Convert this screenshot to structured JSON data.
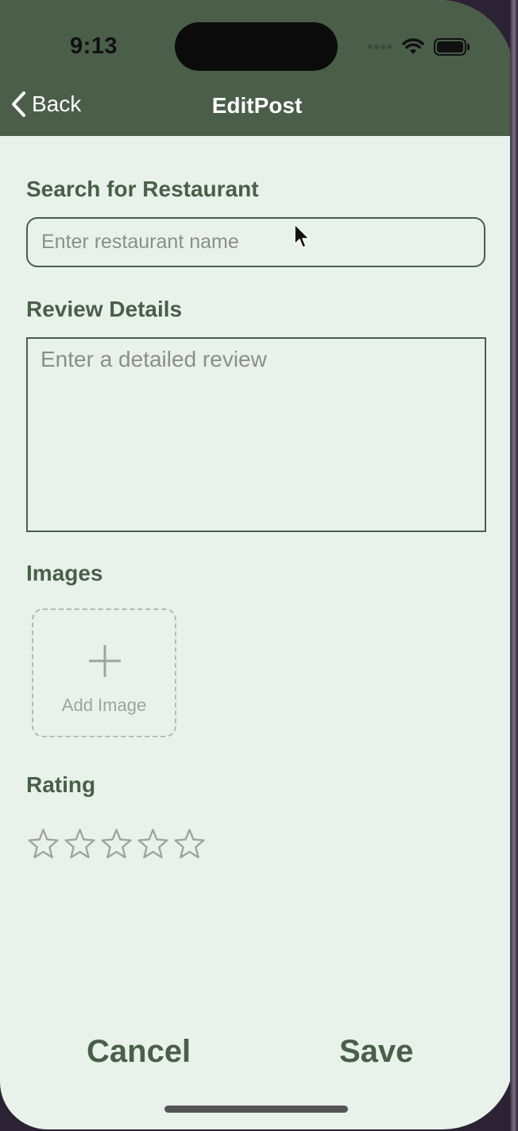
{
  "status_bar": {
    "time": "9:13"
  },
  "nav": {
    "back_label": "Back",
    "title": "EditPost"
  },
  "search": {
    "label": "Search for Restaurant",
    "placeholder": "Enter restaurant name",
    "value": ""
  },
  "review": {
    "label": "Review Details",
    "placeholder": "Enter a detailed review",
    "value": ""
  },
  "images": {
    "label": "Images",
    "add_label": "Add Image"
  },
  "rating": {
    "label": "Rating",
    "value": 0,
    "max": 5
  },
  "footer": {
    "cancel_label": "Cancel",
    "save_label": "Save"
  },
  "colors": {
    "header_bg": "#4a5e4a",
    "page_bg": "#e8f2eb",
    "accent": "#4a5e4a"
  }
}
